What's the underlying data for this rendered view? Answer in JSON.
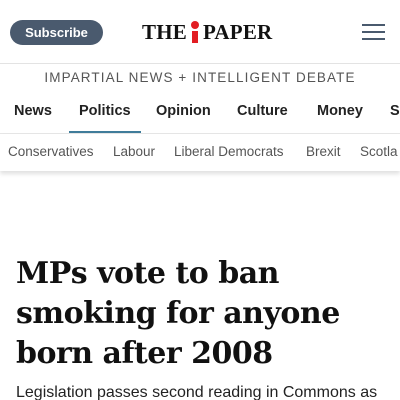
{
  "header": {
    "subscribe_label": "Subscribe",
    "logo_text_left": "THE",
    "logo_text_right": "PAPER",
    "logo_accent_color": "#e21d23",
    "menu_icon": "hamburger-menu-icon",
    "tagline": "IMPARTIAL NEWS + INTELLIGENT DEBATE"
  },
  "nav": {
    "items": [
      {
        "label": "News"
      },
      {
        "label": "Politics",
        "active": true
      },
      {
        "label": "Opinion"
      },
      {
        "label": "Culture"
      },
      {
        "label": "Money"
      },
      {
        "label": "S"
      }
    ],
    "active_color": "#3f7c9a"
  },
  "subnav": {
    "items": [
      {
        "label": "Conservatives"
      },
      {
        "label": "Labour"
      },
      {
        "label": "Liberal Democrats"
      },
      {
        "label": "Brexit"
      },
      {
        "label": "Scotla"
      }
    ]
  },
  "article": {
    "headline": "MPs vote to ban smoking for anyone born after 2008",
    "standfirst": "Legislation passes second reading in Commons as"
  },
  "colors": {
    "subscribe_bg": "#4a5a6e",
    "text": "#111111"
  }
}
